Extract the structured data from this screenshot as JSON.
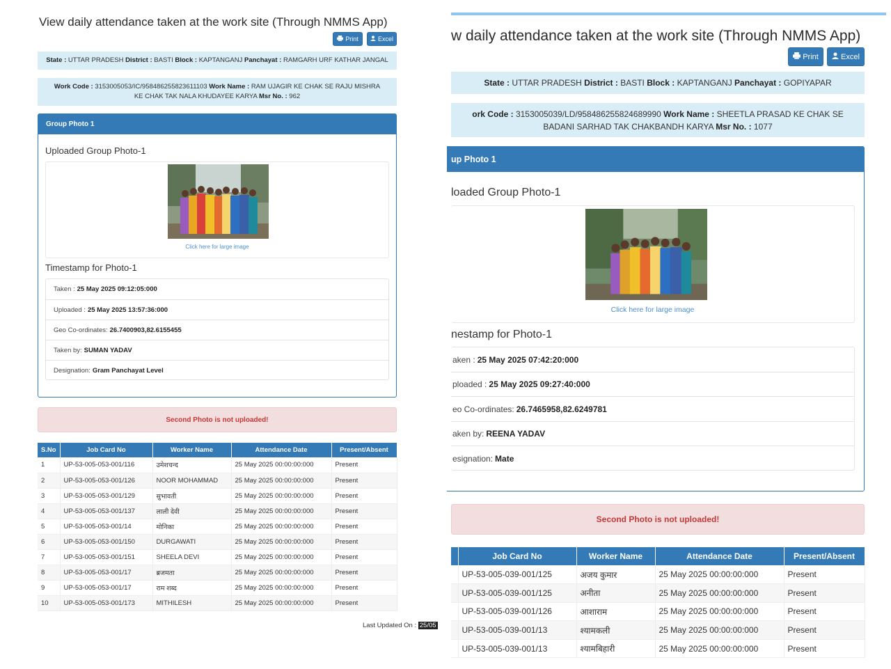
{
  "left": {
    "title": "View daily attendance taken at the work site (Through NMMS App)",
    "print_label": "Print",
    "excel_label": "Excel",
    "location": {
      "state_label": "State :",
      "state": "UTTAR PRADESH",
      "district_label": "District :",
      "district": "BASTI",
      "block_label": "Block :",
      "block": "KAPTANGANJ",
      "panchayat_label": "Panchayat :",
      "panchayat": "RAMGARH URF KATHAR JANGAL"
    },
    "work": {
      "code_label": "Work Code :",
      "code": "3153005053/IC/958486255823611103",
      "name_label": "Work Name :",
      "name": "RAM UJAGIR KE CHAK SE RAJU MISHRA KE CHAK TAK NALA KHUDAYEE KARYA",
      "msr_label": "Msr No. :",
      "msr": "962"
    },
    "group_photo_header": "Group Photo 1",
    "uploaded_title": "Uploaded Group Photo-1",
    "photo_link": "Click here for large image",
    "timestamp_title": "Timestamp for Photo-1",
    "timestamps": [
      {
        "label": "Taken :",
        "value": "25 May 2025 09:12:05:000"
      },
      {
        "label": "Uploaded :",
        "value": "25 May 2025 13:57:36:000"
      },
      {
        "label": "Geo Co-ordinates:",
        "value": "26.7400903,82.6155455"
      },
      {
        "label": "Taken by:",
        "value": "SUMAN YADAV"
      },
      {
        "label": "Designation:",
        "value": "Gram Panchayat Level"
      }
    ],
    "alert": "Second Photo is not uploaded!",
    "table": {
      "headers": [
        "S.No",
        "Job Card No",
        "Worker Name",
        "Attendance Date",
        "Present/Absent"
      ],
      "rows": [
        [
          "1",
          "UP-53-005-053-001/116",
          "उमेशचन्द",
          "25 May 2025 00:00:00:000",
          "Present"
        ],
        [
          "2",
          "UP-53-005-053-001/126",
          "NOOR MOHAMMAD",
          "25 May 2025 00:00:00:000",
          "Present"
        ],
        [
          "3",
          "UP-53-005-053-001/129",
          "सुभावती",
          "25 May 2025 00:00:00:000",
          "Present"
        ],
        [
          "4",
          "UP-53-005-053-001/137",
          "लाली देवी",
          "25 May 2025 00:00:00:000",
          "Present"
        ],
        [
          "5",
          "UP-53-005-053-001/14",
          "मोनिका",
          "25 May 2025 00:00:00:000",
          "Present"
        ],
        [
          "6",
          "UP-53-005-053-001/150",
          "DURGAWATI",
          "25 May 2025 00:00:00:000",
          "Present"
        ],
        [
          "7",
          "UP-53-005-053-001/151",
          "SHEELA DEVI",
          "25 May 2025 00:00:00:000",
          "Present"
        ],
        [
          "8",
          "UP-53-005-053-001/17",
          "ब्रजमता",
          "25 May 2025 00:00:00:000",
          "Present"
        ],
        [
          "9",
          "UP-53-005-053-001/17",
          "राम शब्द",
          "25 May 2025 00:00:00:000",
          "Present"
        ],
        [
          "10",
          "UP-53-005-053-001/173",
          "MITHILESH",
          "25 May 2025 00:00:00:000",
          "Present"
        ]
      ]
    },
    "last_updated_label": "Last Updated On :",
    "last_updated_value": "25/05"
  },
  "right": {
    "title": "w daily attendance taken at the work site (Through NMMS App)",
    "print_label": "Print",
    "excel_label": "Excel",
    "location": {
      "state_label": "State :",
      "state": "UTTAR PRADESH",
      "district_label": "District :",
      "district": "BASTI",
      "block_label": "Block :",
      "block": "KAPTANGANJ",
      "panchayat_label": "Panchayat :",
      "panchayat": "GOPIYAPAR"
    },
    "work": {
      "code_label": "ork Code :",
      "code": "3153005039/LD/958486255824689990",
      "name_label": "Work Name :",
      "name": "SHEETLA PRASAD KE CHAK SE BADANI SARHAD TAK CHAKBANDH KARYA",
      "msr_label": "Msr No. :",
      "msr": "1077"
    },
    "group_photo_header": "up Photo 1",
    "uploaded_title": "loaded Group Photo-1",
    "photo_link": "Click here for large image",
    "timestamp_title": "nestamp for Photo-1",
    "timestamps": [
      {
        "label": "aken :",
        "value": "25 May 2025 07:42:20:000"
      },
      {
        "label": "ploaded :",
        "value": "25 May 2025 09:27:40:000"
      },
      {
        "label": "eo Co-ordinates:",
        "value": "26.7465958,82.6249781"
      },
      {
        "label": "aken by:",
        "value": "REENA YADAV"
      },
      {
        "label": "esignation:",
        "value": "Mate"
      }
    ],
    "alert": "Second Photo is not uploaded!",
    "table": {
      "headers": [
        "Job Card No",
        "Worker Name",
        "Attendance Date",
        "Present/Absent"
      ],
      "rows": [
        [
          "UP-53-005-039-001/125",
          "अजय कुमार",
          "25 May 2025 00:00:00:000",
          "Present"
        ],
        [
          "UP-53-005-039-001/125",
          "अनीता",
          "25 May 2025 00:00:00:000",
          "Present"
        ],
        [
          "UP-53-005-039-001/126",
          "आशाराम",
          "25 May 2025 00:00:00:000",
          "Present"
        ],
        [
          "UP-53-005-039-001/13",
          "श्यामकली",
          "25 May 2025 00:00:00:000",
          "Present"
        ],
        [
          "UP-53-005-039-001/13",
          "श्यामबिहारी",
          "25 May 2025 00:00:00:000",
          "Present"
        ]
      ]
    }
  },
  "colors": {
    "primary": "#337ab7",
    "info_bg": "#d9edf7",
    "danger_bg": "#f2dede",
    "danger_text": "#c23a37",
    "link": "#4a8fcf"
  }
}
